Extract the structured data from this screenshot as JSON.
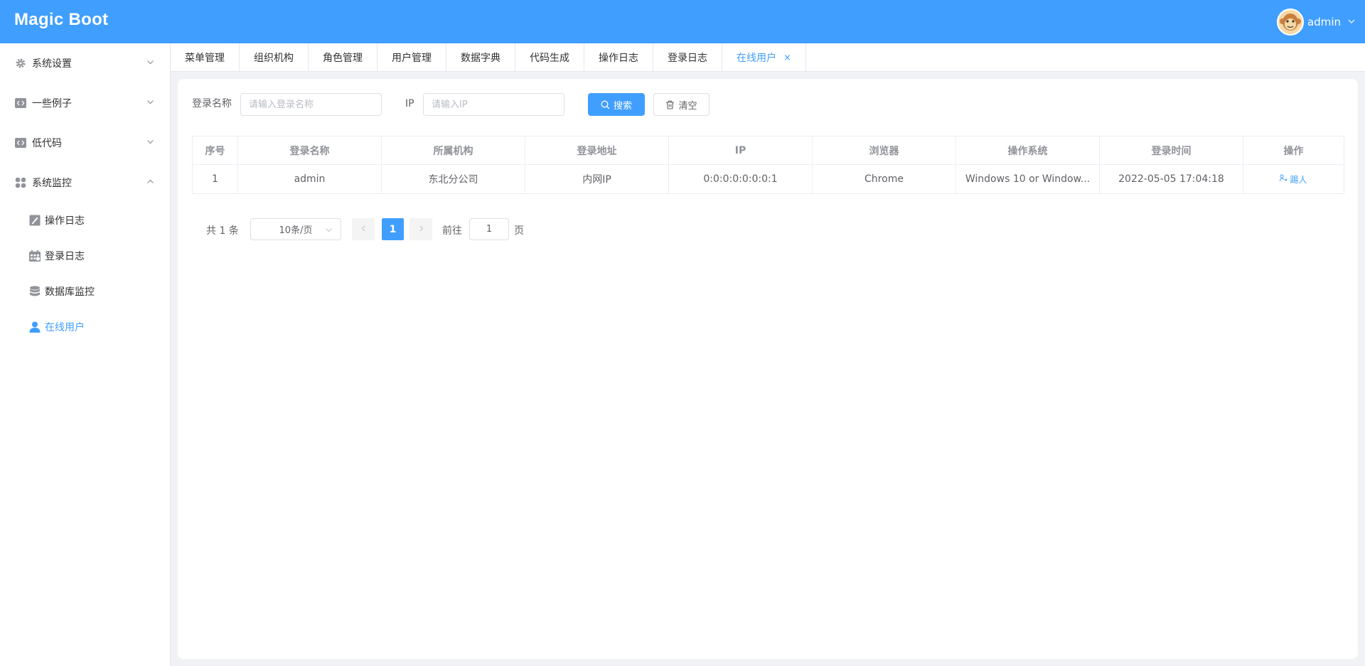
{
  "app": {
    "title": "Magic Boot"
  },
  "user": {
    "name": "admin"
  },
  "sidebar": {
    "items": [
      {
        "label": "系统设置",
        "icon": "gear-icon"
      },
      {
        "label": "一些例子",
        "icon": "code-icon"
      },
      {
        "label": "低代码",
        "icon": "code-icon"
      },
      {
        "label": "系统监控",
        "icon": "grid-icon"
      }
    ],
    "sub_items": [
      {
        "label": "操作日志",
        "icon": "edit-log-icon"
      },
      {
        "label": "登录日志",
        "icon": "calendar-icon"
      },
      {
        "label": "数据库监控",
        "icon": "database-icon"
      },
      {
        "label": "在线用户",
        "icon": "user-icon"
      }
    ]
  },
  "tabs": [
    "菜单管理",
    "组织机构",
    "角色管理",
    "用户管理",
    "数据字典",
    "代码生成",
    "操作日志",
    "登录日志",
    "在线用户"
  ],
  "tab_close": "×",
  "search": {
    "login_name_label": "登录名称",
    "login_name_placeholder": "请输入登录名称",
    "ip_label": "IP",
    "ip_placeholder": "请输入IP",
    "search_button": "搜索",
    "clear_button": "清空"
  },
  "table": {
    "columns": [
      "序号",
      "登录名称",
      "所属机构",
      "登录地址",
      "IP",
      "浏览器",
      "操作系统",
      "登录时间",
      "操作"
    ],
    "rows": [
      [
        "1",
        "admin",
        "东北分公司",
        "内网IP",
        "0:0:0:0:0:0:0:1",
        "Chrome",
        "Windows 10 or Window...",
        "2022-05-05 17:04:18",
        "踢人"
      ]
    ]
  },
  "pagination": {
    "total": "共 1 条",
    "page_size": "10条/页",
    "current_page": "1",
    "goto_label": "前往",
    "goto_value": "1",
    "page_unit": "页"
  },
  "colors": {
    "primary": "#409eff",
    "sidebar_bg": "#ffffff",
    "page_bg": "#f0f2f5"
  }
}
